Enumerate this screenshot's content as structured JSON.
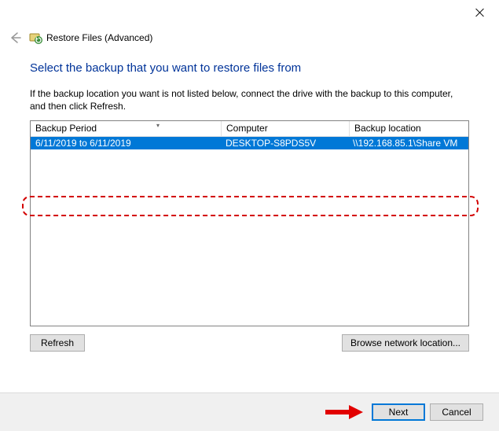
{
  "window": {
    "title": "Restore Files (Advanced)"
  },
  "heading": "Select the backup that you want to restore files from",
  "instruction": "If the backup location you want is not listed below, connect the drive with the backup to this computer, and then click Refresh.",
  "columns": {
    "period": "Backup Period",
    "computer": "Computer",
    "location": "Backup location"
  },
  "rows": [
    {
      "period": "6/11/2019 to 6/11/2019",
      "computer": "DESKTOP-S8PDS5V",
      "location": "\\\\192.168.85.1\\Share VM"
    }
  ],
  "buttons": {
    "refresh": "Refresh",
    "browse": "Browse network location...",
    "next": "Next",
    "cancel": "Cancel"
  }
}
